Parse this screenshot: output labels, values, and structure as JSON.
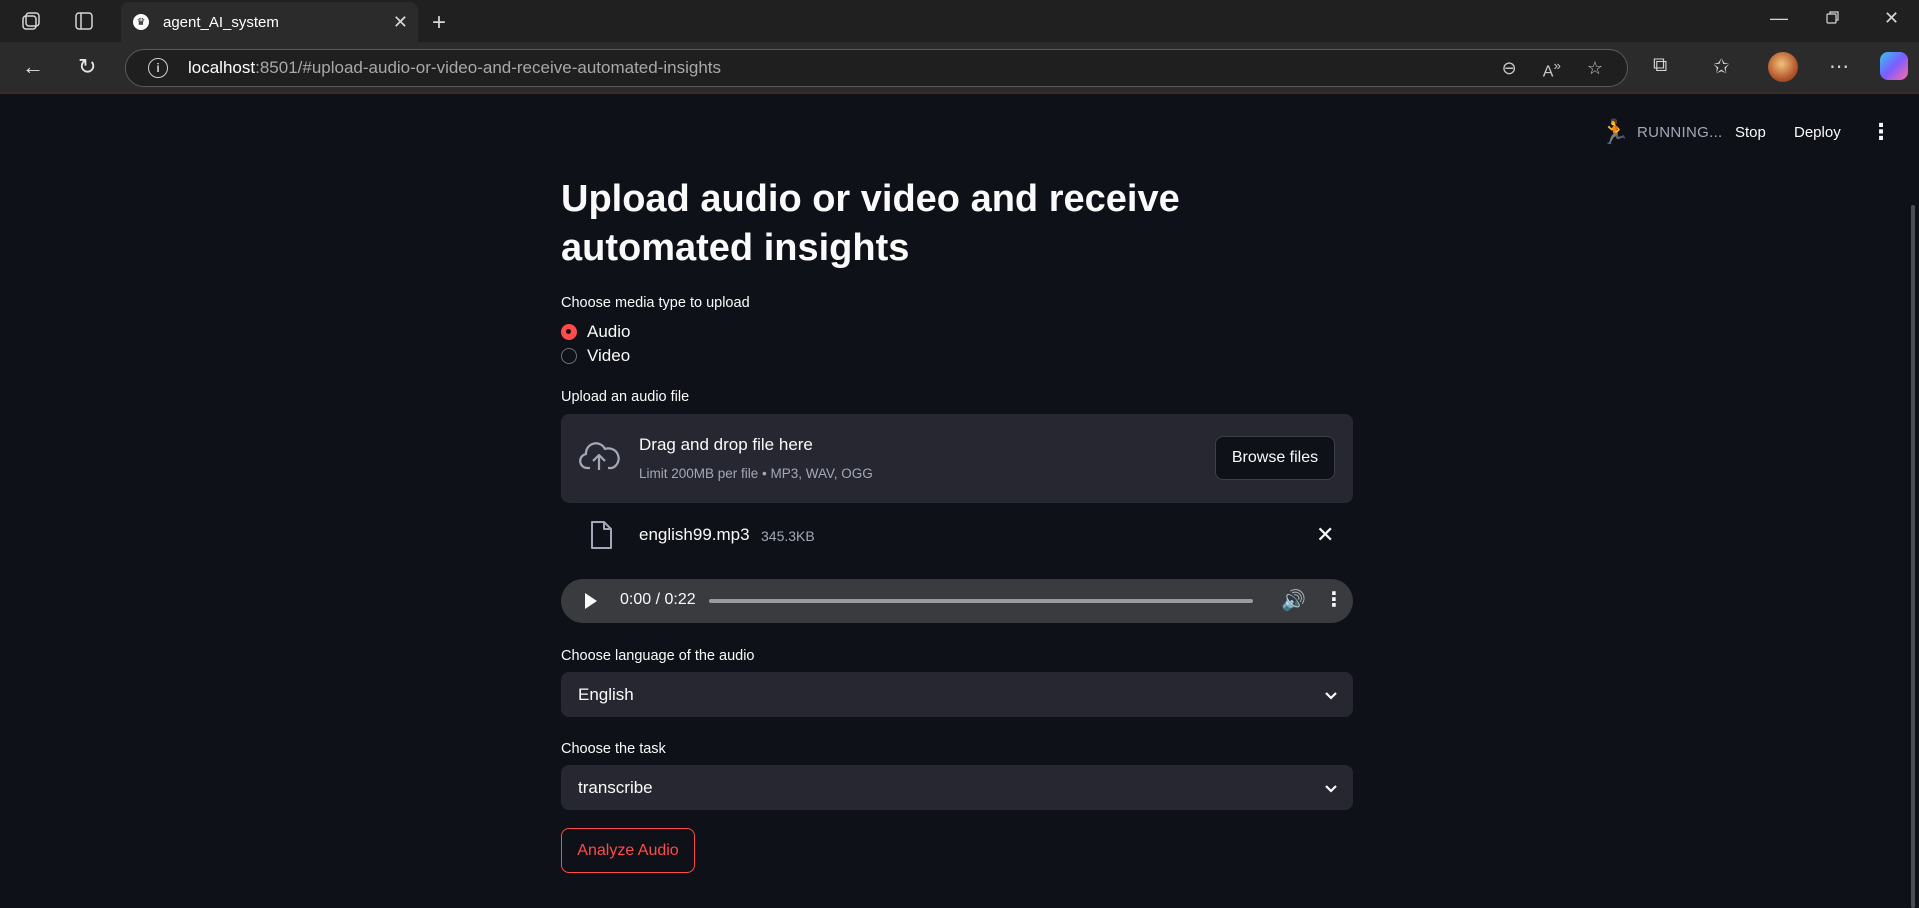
{
  "browser": {
    "tab_title": "agent_AI_system",
    "url_host": "localhost",
    "url_rest": ":8501/#upload-audio-or-video-and-receive-automated-insights"
  },
  "app_header": {
    "status": "RUNNING...",
    "stop_label": "Stop",
    "deploy_label": "Deploy"
  },
  "main": {
    "title": "Upload audio or video and receive automated insights",
    "media_type": {
      "label": "Choose media type to upload",
      "options": [
        {
          "label": "Audio",
          "selected": true
        },
        {
          "label": "Video",
          "selected": false
        }
      ]
    },
    "uploader": {
      "label": "Upload an audio file",
      "drop_title": "Drag and drop file here",
      "drop_sub": "Limit 200MB per file • MP3, WAV, OGG",
      "browse_label": "Browse files",
      "file_name": "english99.mp3",
      "file_size": "345.3KB"
    },
    "player": {
      "time": "0:00 / 0:22"
    },
    "language": {
      "label": "Choose language of the audio",
      "value": "English"
    },
    "task": {
      "label": "Choose the task",
      "value": "transcribe"
    },
    "analyze_label": "Analyze Audio"
  },
  "colors": {
    "accent": "#ff4b4b",
    "background": "#0e1117",
    "input_bg": "#262730"
  }
}
